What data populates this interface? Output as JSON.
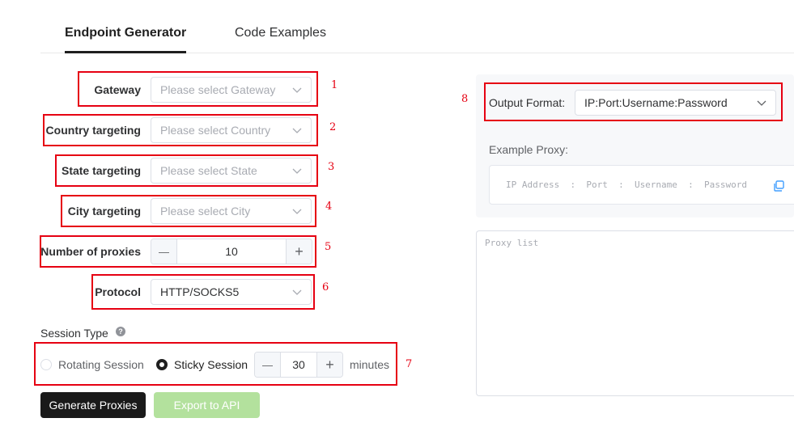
{
  "tabs": [
    {
      "label": "Endpoint Generator",
      "active": true
    },
    {
      "label": "Code Examples",
      "active": false
    }
  ],
  "form": {
    "gateway": {
      "label": "Gateway",
      "placeholder": "Please select Gateway",
      "marker": "1"
    },
    "country": {
      "label": "Country targeting",
      "placeholder": "Please select Country",
      "marker": "2"
    },
    "state": {
      "label": "State targeting",
      "placeholder": "Please select State",
      "marker": "3"
    },
    "city": {
      "label": "City targeting",
      "placeholder": "Please select City",
      "marker": "4"
    },
    "proxies": {
      "label": "Number of proxies",
      "value": "10",
      "minus": "—",
      "plus": "+",
      "marker": "5"
    },
    "protocol": {
      "label": "Protocol",
      "value": "HTTP/SOCKS5",
      "marker": "6"
    }
  },
  "session": {
    "title": "Session Type",
    "help_icon": "question-circle-icon",
    "rotating_label": "Rotating Session",
    "sticky_label": "Sticky Session",
    "selected": "sticky",
    "minutes_value": "30",
    "minutes_label": "minutes",
    "marker": "7"
  },
  "buttons": {
    "generate": "Generate Proxies",
    "export": "Export to API"
  },
  "output": {
    "label": "Output Format:",
    "value": "IP:Port:Username:Password",
    "marker": "8",
    "example_label": "Example Proxy:",
    "example_text": "IP Address  :  Port  :  Username  :  Password",
    "copy_icon": "copy-icon",
    "proxy_list_placeholder": "Proxy list"
  },
  "colors": {
    "accent_dark": "#1a1a1a",
    "disabled_green": "#b3e19d",
    "annotation_red": "#e60012",
    "copy_blue": "#409eff"
  }
}
